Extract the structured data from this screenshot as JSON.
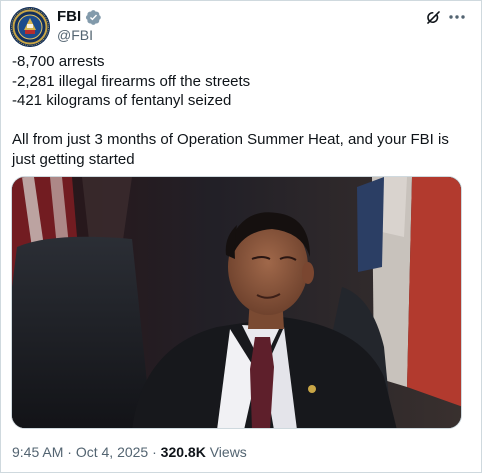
{
  "author": {
    "name": "FBI",
    "handle": "@FBI",
    "verified": true,
    "avatar_icon": "fbi-seal-icon"
  },
  "actions": {
    "grok_icon": "grok-icon",
    "more_icon": "more-horizontal-icon"
  },
  "tweet": {
    "lines": [
      "-8,700 arrests",
      "-2,281 illegal firearms off the streets",
      "-421 kilograms of fentanyl seized"
    ],
    "paragraph": "All from just 3 months of Operation Summer Heat, and your FBI is just getting started"
  },
  "media": {
    "type": "image",
    "description_icon": "video-still-man-in-suit"
  },
  "meta": {
    "time": "9:45 AM",
    "separator": " · ",
    "date": "Oct 4, 2025",
    "separator2": " · ",
    "views_count": "320.8K",
    "views_label": " Views"
  },
  "colors": {
    "text": "#0f1419",
    "secondary": "#536471",
    "verified": "#829aab",
    "border": "#cfd9de"
  }
}
